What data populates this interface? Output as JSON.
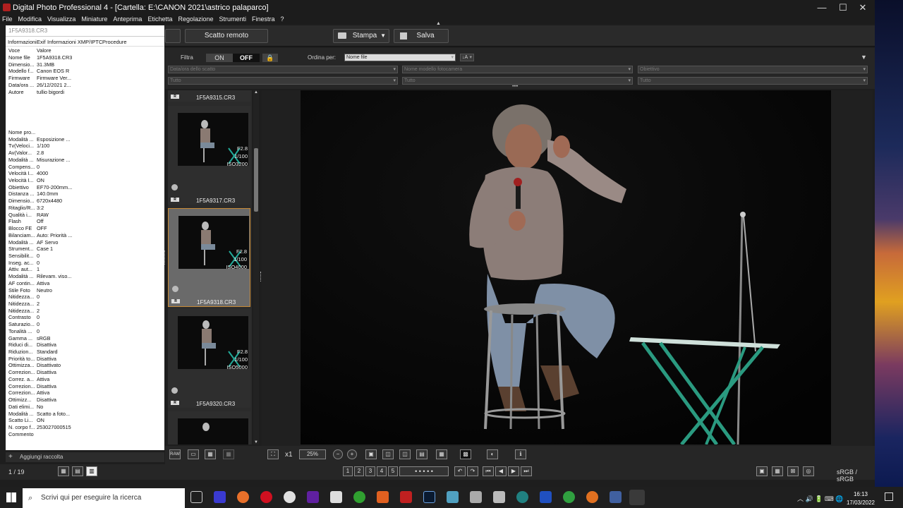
{
  "window": {
    "title": "Digital Photo Professional 4 - [Cartella: E:\\CANON 2021\\astrico palaparco]",
    "min": "—",
    "max": "☐",
    "close": "✕"
  },
  "menu": [
    "File",
    "Modifica",
    "Visualizza",
    "Miniature",
    "Anteprima",
    "Etichetta",
    "Regolazione",
    "Strumenti",
    "Finestra",
    "?"
  ],
  "toolbar": {
    "remote": "Scatto remoto",
    "print": "Stampa",
    "save": "Salva"
  },
  "filter": {
    "label": "Filtra",
    "on": "ON",
    "off": "OFF",
    "sort_label": "Ordina per:",
    "sort_value": "Nome file",
    "dd1": "Data/ora dello scatto",
    "dd2": "Nome modello fotocamera",
    "dd3": "Obiettivo",
    "all1": "Tutto",
    "all2": "Tutto",
    "all3": "Tutto"
  },
  "info": {
    "filename": "1F5A9318.CR3",
    "tabs": [
      "Informazioni",
      "Exif",
      "Informazioni XMP/IPTC",
      "Procedure"
    ],
    "header": {
      "k": "Voce",
      "v": "Valore"
    },
    "rows_top": [
      {
        "k": "Nome file",
        "v": "1F5A9318.CR3"
      },
      {
        "k": "Dimensio...",
        "v": "31.3MB"
      },
      {
        "k": "Modello f...",
        "v": "Canon EOS R"
      },
      {
        "k": "Firmware",
        "v": "Firmware Ver..."
      },
      {
        "k": "Data/ora ...",
        "v": "26/12/2021 2..."
      },
      {
        "k": "Autore",
        "v": "tullio bigordi"
      }
    ],
    "rows_bottom": [
      {
        "k": "Nome pro...",
        "v": ""
      },
      {
        "k": "Modalità ...",
        "v": "Esposizione ..."
      },
      {
        "k": "Tv(Veloci...",
        "v": "1/100"
      },
      {
        "k": "Av(Valor...",
        "v": "2.8"
      },
      {
        "k": "Modalità ...",
        "v": "Misurazione ..."
      },
      {
        "k": "Compens...",
        "v": "0"
      },
      {
        "k": "Velocità I...",
        "v": "4000"
      },
      {
        "k": "Velocità I...",
        "v": "ON"
      },
      {
        "k": "Obiettivo",
        "v": "EF70-200mm..."
      },
      {
        "k": "Distanza ...",
        "v": "140.0mm"
      },
      {
        "k": "Dimensio...",
        "v": "6720x4480"
      },
      {
        "k": "Ritaglio/R...",
        "v": "3:2"
      },
      {
        "k": "Qualità i...",
        "v": "RAW"
      },
      {
        "k": "Flash",
        "v": "Off"
      },
      {
        "k": "Blocco FE",
        "v": "OFF"
      },
      {
        "k": "Bilanciam...",
        "v": "Auto: Priorità ..."
      },
      {
        "k": "Modalità ...",
        "v": "AF Servo"
      },
      {
        "k": "Strument...",
        "v": "Case 1"
      },
      {
        "k": "Sensibilit...",
        "v": "0"
      },
      {
        "k": "Inseg. ac...",
        "v": "0"
      },
      {
        "k": "Attiv. aut...",
        "v": "1"
      },
      {
        "k": "Modalità ...",
        "v": "Rilevam. viso..."
      },
      {
        "k": "AF contin...",
        "v": "Attiva"
      },
      {
        "k": "Stile Foto",
        "v": "Neutro"
      },
      {
        "k": "Nitidezza...",
        "v": "0"
      },
      {
        "k": "Nitidezza...",
        "v": "2"
      },
      {
        "k": "Nitidezza...",
        "v": "2"
      },
      {
        "k": "Contrasto",
        "v": "0"
      },
      {
        "k": "Saturazio...",
        "v": "0"
      },
      {
        "k": "Tonalità ...",
        "v": "0"
      },
      {
        "k": "Gamma ...",
        "v": "sRGB"
      },
      {
        "k": "Riduci di...",
        "v": "Disattiva"
      },
      {
        "k": "Riduzion...",
        "v": "Standard"
      },
      {
        "k": "Priorità to...",
        "v": "Disattiva"
      },
      {
        "k": "Ottimizza...",
        "v": "Disattivato"
      },
      {
        "k": "Correzion...",
        "v": "Disattiva"
      },
      {
        "k": "Correz. a...",
        "v": "Attiva"
      },
      {
        "k": "Correzion...",
        "v": "Disattiva"
      },
      {
        "k": "Correzion...",
        "v": "Attiva"
      },
      {
        "k": "Ottimizz...",
        "v": "Disattiva"
      },
      {
        "k": "Dati elimi...",
        "v": "No"
      },
      {
        "k": "Modalità ...",
        "v": "Scatto a foto..."
      },
      {
        "k": "Scatto Li...",
        "v": "ON"
      },
      {
        "k": "N. corpo f...",
        "v": "253027000515"
      },
      {
        "k": "Commento",
        "v": ""
      }
    ],
    "add_collection": "Aggiungi raccolta"
  },
  "thumbs": [
    {
      "file": "1F5A9315.CR3",
      "f": "",
      "tv": "",
      "iso": "",
      "badge": "R"
    },
    {
      "file": "1F5A9317.CR3",
      "f": "F2.8",
      "tv": "1/100",
      "iso": "ISO3200",
      "badge": "R"
    },
    {
      "file": "1F5A9318.CR3",
      "f": "F2.8",
      "tv": "1/100",
      "iso": "ISO4000",
      "badge": "R"
    },
    {
      "file": "1F5A9320.CR3",
      "f": "F2.8",
      "tv": "1/100",
      "iso": "ISO5000",
      "badge": "R"
    }
  ],
  "view": {
    "zoom_x1": "x1",
    "zoom": "25%",
    "raw": "RAW"
  },
  "status": {
    "count": "1 / 19",
    "colorspace": "sRGB / sRGB"
  },
  "taskbar": {
    "search": "Scrivi qui per eseguire la ricerca",
    "time": "16:13",
    "date": "17/03/2022"
  }
}
